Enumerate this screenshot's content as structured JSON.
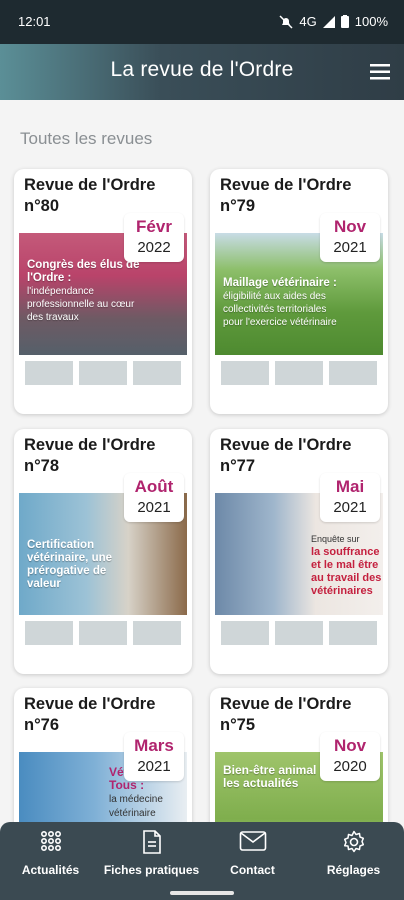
{
  "status": {
    "time": "12:01",
    "network": "4G",
    "battery": "100%"
  },
  "header": {
    "title": "La revue de l'Ordre"
  },
  "section": {
    "title": "Toutes les revues"
  },
  "issues": [
    {
      "title": "Revue de l'Ordre",
      "number": "n°80",
      "month": "Févr",
      "year": "2022",
      "cover_headline": "Congrès des élus de l'Ordre :",
      "cover_sub": "l'indépendance professionnelle au cœur des travaux"
    },
    {
      "title": "Revue de l'Ordre",
      "number": "n°79",
      "month": "Nov",
      "year": "2021",
      "cover_headline": "Maillage vétérinaire :",
      "cover_sub": "éligibilité aux aides des collectivités territoriales pour l'exercice vétérinaire"
    },
    {
      "title": "Revue de l'Ordre",
      "number": "n°78",
      "month": "Août",
      "year": "2021",
      "cover_headline": "Certification vétérinaire, une prérogative de valeur",
      "cover_sub": ""
    },
    {
      "title": "Revue de l'Ordre",
      "number": "n°77",
      "month": "Mai",
      "year": "2021",
      "cover_headline": "la souffrance et le mal être au travail des vétérinaires",
      "cover_sub": "Enquête sur"
    },
    {
      "title": "Revue de l'Ordre",
      "number": "n°76",
      "month": "Mars",
      "year": "2021",
      "cover_headline": "Véto Pour Tous :",
      "cover_sub": "la médecine vétérinaire"
    },
    {
      "title": "Revue de l'Ordre",
      "number": "n°75",
      "month": "Nov",
      "year": "2020",
      "cover_headline": "Bien-être animal : les actualités",
      "cover_sub": ""
    }
  ],
  "nav": [
    {
      "label": "Actualités",
      "icon": "grid-icon"
    },
    {
      "label": "Fiches pratiques",
      "icon": "document-icon"
    },
    {
      "label": "Contact",
      "icon": "envelope-icon"
    },
    {
      "label": "Réglages",
      "icon": "gear-icon"
    }
  ],
  "colors": {
    "accent": "#b0246e",
    "header": "#2f3d46",
    "nav": "#3b4a52"
  }
}
